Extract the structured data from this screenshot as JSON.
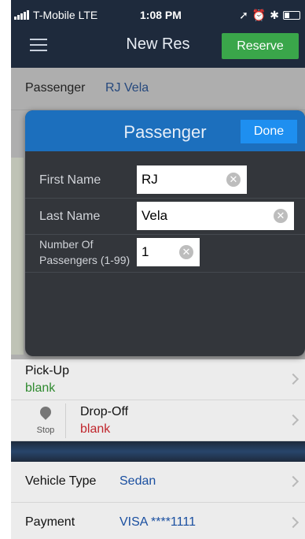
{
  "status_bar": {
    "carrier": "T-Mobile  LTE",
    "time": "1:08 PM",
    "icons": [
      "location-icon",
      "alarm-icon",
      "bluetooth-icon",
      "battery-icon"
    ]
  },
  "nav": {
    "title": "New Res",
    "reserve_label": "Reserve"
  },
  "form": {
    "passenger_label": "Passenger",
    "passenger_value": "RJ Vela",
    "pickup_label": "Pick-Up",
    "pickup_value": "blank",
    "stop_label": "Stop",
    "dropoff_label": "Drop-Off",
    "dropoff_value": "blank",
    "vehicle_label": "Vehicle Type",
    "vehicle_value": "Sedan",
    "payment_label": "Payment",
    "payment_value": "VISA ****1111"
  },
  "modal": {
    "title": "Passenger",
    "done_label": "Done",
    "first_name_label": "First Name",
    "first_name_value": "RJ",
    "last_name_label": "Last Name",
    "last_name_value": "Vela",
    "count_label_line1": "Number Of",
    "count_label_line2": "Passengers (1-99)",
    "count_value": "1"
  },
  "colors": {
    "nav_bg": "#1e2a3c",
    "reserve_green": "#3aa64a",
    "modal_header": "#1c6fbd",
    "done_button": "#1e8ff0",
    "link_blue": "#1a4fa0",
    "blank_green": "#2f8a2f",
    "blank_red": "#c0262d"
  }
}
